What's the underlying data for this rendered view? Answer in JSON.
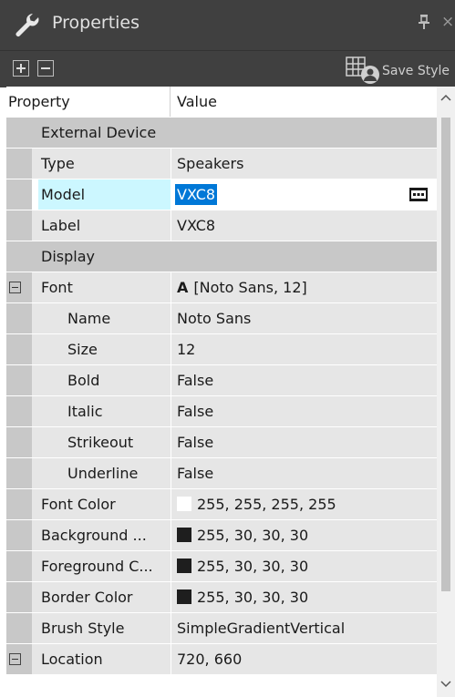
{
  "window": {
    "title": "Properties"
  },
  "toolbar": {
    "save_style_label": "Save Style"
  },
  "grid": {
    "header": {
      "property": "Property",
      "value": "Value"
    },
    "rows": [
      {
        "kind": "category",
        "label": "External Device"
      },
      {
        "kind": "prop",
        "name": "Type",
        "value": "Speakers"
      },
      {
        "kind": "prop",
        "name": "Model",
        "value": "VXC8",
        "selected": true
      },
      {
        "kind": "prop",
        "name": "Label",
        "value": "VXC8"
      },
      {
        "kind": "category",
        "label": "Display"
      },
      {
        "kind": "prop",
        "name": "Font",
        "value": "[Noto Sans, 12]",
        "glyph": "A",
        "expandable": true
      },
      {
        "kind": "sub",
        "name": "Name",
        "value": "Noto Sans"
      },
      {
        "kind": "sub",
        "name": "Size",
        "value": "12"
      },
      {
        "kind": "sub",
        "name": "Bold",
        "value": "False"
      },
      {
        "kind": "sub",
        "name": "Italic",
        "value": "False"
      },
      {
        "kind": "sub",
        "name": "Strikeout",
        "value": "False"
      },
      {
        "kind": "sub",
        "name": "Underline",
        "value": "False"
      },
      {
        "kind": "prop",
        "name": "Font Color",
        "value": "255, 255, 255, 255",
        "swatch": "#ffffff"
      },
      {
        "kind": "prop",
        "name": "Background ...",
        "value": "255, 30, 30, 30",
        "swatch": "#1e1e1e"
      },
      {
        "kind": "prop",
        "name": "Foreground C...",
        "value": "255, 30, 30, 30",
        "swatch": "#1e1e1e"
      },
      {
        "kind": "prop",
        "name": "Border Color",
        "value": "255, 30, 30, 30",
        "swatch": "#1e1e1e"
      },
      {
        "kind": "prop",
        "name": "Brush Style",
        "value": "SimpleGradientVertical"
      },
      {
        "kind": "prop",
        "name": "Location",
        "value": "720, 660",
        "expandable": true
      }
    ]
  },
  "colors": {
    "titlebar_bg": "#404040",
    "category_bg": "#c8c8c8",
    "row_bg": "#e6e6e6",
    "selection_blue": "#0078d7",
    "name_highlight": "#ccf7ff"
  },
  "icons": {
    "title": "wrench-icon",
    "pin": "pin-icon",
    "close": "close-icon",
    "expand_all": "expand-all-icon",
    "collapse_all": "collapse-all-icon",
    "save_style": "save-style-icon",
    "ellipsis": "ellipsis-button-icon"
  }
}
